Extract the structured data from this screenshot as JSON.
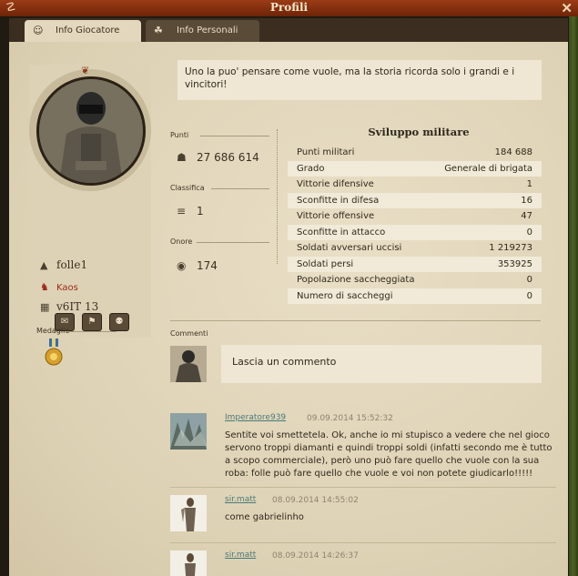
{
  "window": {
    "title": "Profili"
  },
  "tabs": [
    {
      "label": "Info Giocatore",
      "icon": "player-icon"
    },
    {
      "label": "Info Personali",
      "icon": "personal-icon"
    }
  ],
  "player": {
    "name": "folle1",
    "alliance": "Kaos",
    "world": "v6IT 13"
  },
  "quote": "Uno la puo' pensare come vuole, ma la storia ricorda solo i grandi e i vincitori!",
  "stats": {
    "points_label": "Punti",
    "points_value": "27 686 614",
    "rank_label": "Classifica",
    "rank_value": "1",
    "honor_label": "Onore",
    "honor_value": "174"
  },
  "medals": {
    "label": "Medaglie"
  },
  "military": {
    "title": "Sviluppo militare",
    "rows": [
      {
        "label": "Punti militari",
        "value": "184 688"
      },
      {
        "label": "Grado",
        "value": "Generale di brigata"
      },
      {
        "label": "Vittorie difensive",
        "value": "1"
      },
      {
        "label": "Sconfitte in difesa",
        "value": "16"
      },
      {
        "label": "Vittorie offensive",
        "value": "47"
      },
      {
        "label": "Sconfitte in attacco",
        "value": "0"
      },
      {
        "label": "Soldati avversari uccisi",
        "value": "1 219273"
      },
      {
        "label": "Soldati persi",
        "value": "353925"
      },
      {
        "label": "Popolazione saccheggiata",
        "value": "0"
      },
      {
        "label": "Numero di saccheggi",
        "value": "0"
      }
    ]
  },
  "comments": {
    "label": "Commenti",
    "input_placeholder": "Lascia un commento",
    "items": [
      {
        "author": "Imperatore939",
        "date": "09.09.2014 15:52:32",
        "text": "Sentite voi smettetela. Ok, anche io mi stupisco a vedere che nel gioco servono troppi diamanti e quindi troppi soldi (infatti secondo me è tutto a scopo commerciale), però uno può fare quello che vuole con la sua roba: folle può fare quello che vuole e voi non potete giudicarlo!!!!!"
      },
      {
        "author": "sir.matt",
        "date": "08.09.2014 14:55:02",
        "text": "come gabrielinho"
      },
      {
        "author": "sir.matt",
        "date": "08.09.2014 14:26:37",
        "text": ""
      }
    ]
  },
  "colors": {
    "titlebar": "#8a3312",
    "panel": "#e3d8bd",
    "link": "#4a7a7a",
    "ally": "#9c2a1a"
  }
}
